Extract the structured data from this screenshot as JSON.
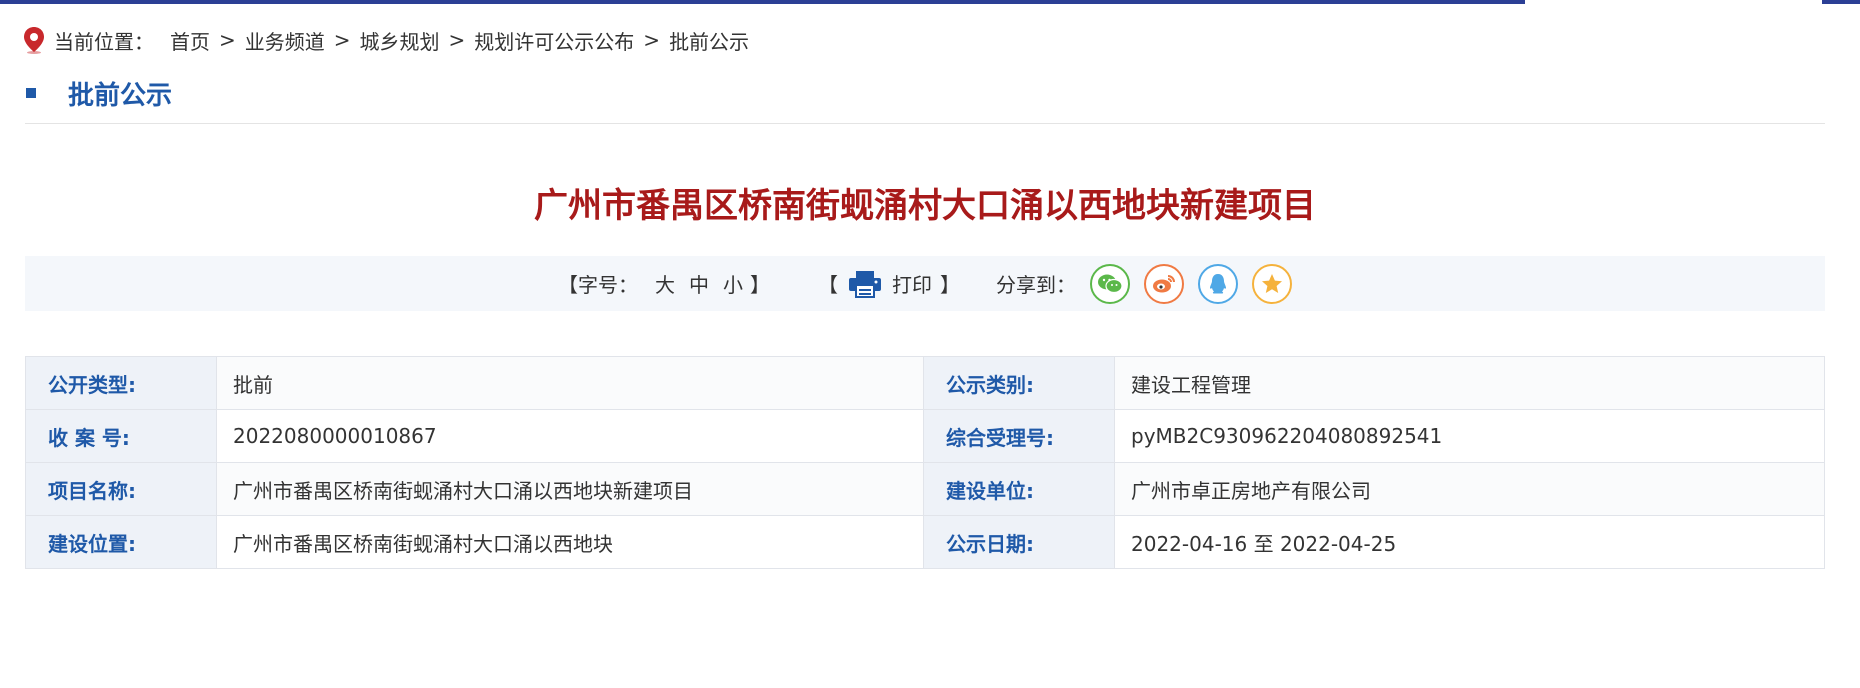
{
  "breadcrumb": {
    "label": "当前位置：",
    "items": [
      "首页",
      "业务频道",
      "城乡规划",
      "规划许可公示公布",
      "批前公示"
    ],
    "separator": ">"
  },
  "section": {
    "title": "批前公示"
  },
  "document": {
    "title": "广州市番禺区桥南街蚬涌村大口涌以西地块新建项目"
  },
  "toolbar": {
    "font_size_open": "【字号：",
    "font_sizes": [
      "大",
      "中",
      "小"
    ],
    "font_size_close": "】",
    "print_open": "【",
    "print_label": "打印",
    "print_close": "】",
    "share_label": "分享到：",
    "share_icons": [
      "wechat-icon",
      "weibo-icon",
      "qq-icon",
      "favorite-star-icon"
    ]
  },
  "info_table": {
    "rows": [
      {
        "k1": "公开类型:",
        "v1": "批前",
        "k2": "公示类别:",
        "v2": "建设工程管理"
      },
      {
        "k1": "收 案 号:",
        "v1": "2022080000010867",
        "k2": "综合受理号:",
        "v2": "pyMB2C930962204080892541"
      },
      {
        "k1": "项目名称:",
        "v1": "广州市番禺区桥南街蚬涌村大口涌以西地块新建项目",
        "k2": "建设单位:",
        "v2": "广州市卓正房地产有限公司"
      },
      {
        "k1": "建设位置:",
        "v1": "广州市番禺区桥南街蚬涌村大口涌以西地块",
        "k2": "公示日期:",
        "v2": "2022-04-16 至 2022-04-25"
      }
    ]
  },
  "colors": {
    "brand_blue": "#1f59a8",
    "title_red": "#a81a1a",
    "top_bar": "#2b3f95",
    "wechat": "#5bb84a",
    "weibo": "#f07a43",
    "qq": "#4fa8e6",
    "favorite": "#f5b23c"
  }
}
